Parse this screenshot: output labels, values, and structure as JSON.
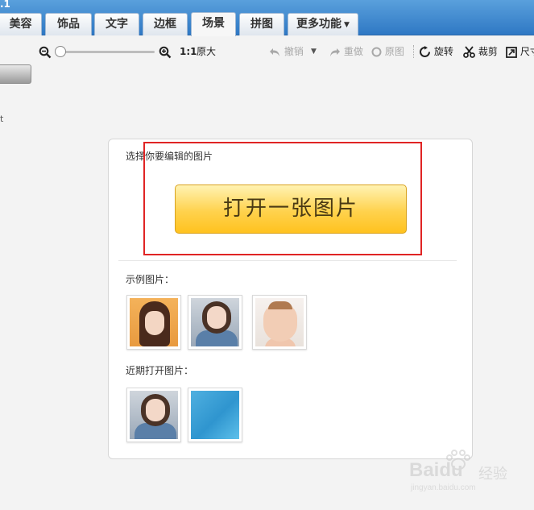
{
  "app": {
    "title_fragment": ".1"
  },
  "tabs": [
    {
      "label": "美容",
      "active": false
    },
    {
      "label": "饰品",
      "active": false
    },
    {
      "label": "文字",
      "active": false
    },
    {
      "label": "边框",
      "active": false
    },
    {
      "label": "场景",
      "active": true
    },
    {
      "label": "拼图",
      "active": false
    },
    {
      "label": "更多功能",
      "active": false
    }
  ],
  "toolbar": {
    "zoom_ratio_label": "1:1",
    "original_size_label": "原大",
    "undo_label": "撤销",
    "redo_label": "重做",
    "original_label": "原图",
    "rotate_label": "旋转",
    "crop_label": "裁剪",
    "size_label": "尺寸"
  },
  "sidebar": {
    "fragment": "t"
  },
  "panel": {
    "choose_label": "选择你要编辑的图片",
    "open_button": "打开一张图片",
    "examples_label": "示例图片：",
    "recent_label": "近期打开图片："
  },
  "watermark": {
    "logo": "Baidu",
    "cn": "经验",
    "url": "jingyan.baidu.com"
  },
  "colors": {
    "accent_blue": "#2f78c4",
    "button_yellow": "#ffd24d",
    "highlight_red": "#e02424"
  }
}
